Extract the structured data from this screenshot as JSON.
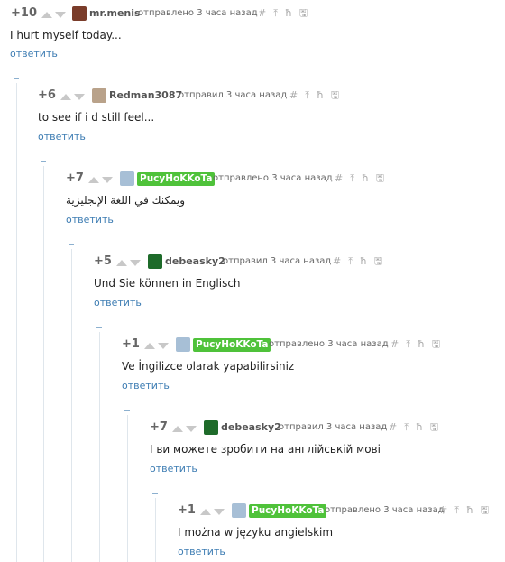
{
  "comments": [
    {
      "rating": "+10",
      "user": "mr.menis",
      "sent": "отправлено 3 часа назад",
      "text": "I hurt myself today...",
      "reply": "ответить"
    },
    {
      "rating": "+6",
      "user": "Redman3087",
      "sent": "отправил 3 часа назад",
      "text": "to see if i d still feel...",
      "reply": "ответить"
    },
    {
      "rating": "+7",
      "user": "PucyHoKKoTa",
      "sent": "отправлено 3 часа назад",
      "text": "ويمكنك في اللغة الإنجليزية",
      "reply": "ответить"
    },
    {
      "rating": "+5",
      "user": "debeasky2",
      "sent": "отправил 3 часа назад",
      "text": "Und Sie können in Englisch",
      "reply": "ответить"
    },
    {
      "rating": "+1",
      "user": "PucyHoKKoTa",
      "sent": "отправлено 3 часа назад",
      "text": "Ve İngilizce olarak yapabilirsiniz",
      "reply": "ответить"
    },
    {
      "rating": "+7",
      "user": "debeasky2",
      "sent": "отправил 3 часа назад",
      "text": "І ви можете зробити на англійській мові",
      "reply": "ответить"
    },
    {
      "rating": "+1",
      "user": "PucyHoKKoTa",
      "sent": "отправлено 3 часа назад",
      "text": "I można w języku angielskim",
      "reply": "ответить"
    }
  ],
  "tools": {
    "link": "#",
    "up": "⤒",
    "tree": "ħ",
    "save": "🖫"
  },
  "colors": {
    "badge": "#4fc23a",
    "link": "#3e7db3",
    "rating": "#666666"
  }
}
